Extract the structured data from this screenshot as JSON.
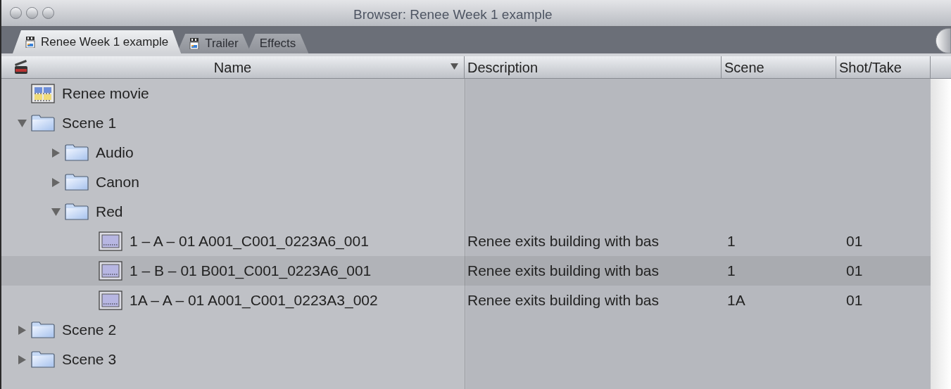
{
  "window": {
    "title": "Browser: Renee Week 1 example"
  },
  "tabs": [
    {
      "label": "Renee Week 1 example",
      "kind": "project",
      "selected": true
    },
    {
      "label": "Trailer",
      "kind": "project",
      "selected": false
    },
    {
      "label": "Effects",
      "kind": "plain",
      "selected": false
    }
  ],
  "table": {
    "columns": [
      {
        "label": "Name",
        "sorted": true
      },
      {
        "label": "Description",
        "sorted": false
      },
      {
        "label": "Scene",
        "sorted": false
      },
      {
        "label": "Shot/Take",
        "sorted": false
      }
    ],
    "items": [
      {
        "kind": "sequence",
        "name": "Renee movie",
        "selected": false
      },
      {
        "kind": "folder",
        "name": "Scene 1",
        "expanded": true,
        "selected": false,
        "children": [
          {
            "kind": "folder",
            "name": "Audio",
            "expanded": false,
            "selected": false
          },
          {
            "kind": "folder",
            "name": "Canon",
            "expanded": false,
            "selected": false
          },
          {
            "kind": "folder",
            "name": "Red",
            "expanded": true,
            "selected": false,
            "children": [
              {
                "kind": "clip",
                "name": "1 – A – 01 A001_C001_0223A6_001",
                "description": "Renee exits building with bas",
                "scene": "1",
                "shot_take": "01",
                "selected": false
              },
              {
                "kind": "clip",
                "name": "1 – B – 01 B001_C001_0223A6_001",
                "description": "Renee exits building with bas",
                "scene": "1",
                "shot_take": "01",
                "selected": true
              },
              {
                "kind": "clip",
                "name": "1A – A – 01 A001_C001_0223A3_002",
                "description": "Renee exits building with bas",
                "scene": "1A",
                "shot_take": "01",
                "selected": false
              }
            ]
          }
        ]
      },
      {
        "kind": "folder",
        "name": "Scene 2",
        "expanded": false,
        "selected": false
      },
      {
        "kind": "folder",
        "name": "Scene 3",
        "expanded": false,
        "selected": false
      }
    ]
  }
}
